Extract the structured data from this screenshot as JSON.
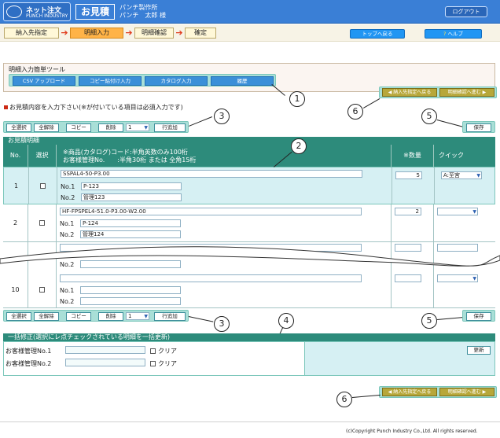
{
  "header": {
    "logo_name": "ネット注文",
    "logo_sub": "PUNCH INDUSTRY",
    "app_title": "お見積",
    "company": "パンチ製作所",
    "user": "パンチ　太郎 様",
    "logout": "ログアウト"
  },
  "steps": [
    {
      "label": "納入先指定"
    },
    {
      "label": "明細入力"
    },
    {
      "label": "明細確認"
    },
    {
      "label": "確定"
    }
  ],
  "step_arrow": "➔",
  "top_nav": {
    "back_top": "トップへ戻る",
    "help": "ヘルプ",
    "help_icon": "?"
  },
  "tools": {
    "title": "明細入力簡単ツール",
    "buttons": [
      "CSV アップロード",
      "コピー貼付け入力",
      "カタログ入力",
      "履歴"
    ]
  },
  "nav_buttons": {
    "back": "◀ 納入先指定へ戻る",
    "next": "明細確認へ進む ▶"
  },
  "instruction": "お見積内容を入力下さい(※が付いている項目は必須入力です)",
  "ops": {
    "select_all": "全選択",
    "deselect_all": "全解除",
    "copy": "コピー",
    "delete": "削除",
    "count": "1",
    "add_row": "行追加",
    "save": "保存"
  },
  "table": {
    "section_title": "お見積明細",
    "col_no": "No.",
    "col_select": "選択",
    "col_code_line1": "※商品(カタログ)コード:半角英数のみ100桁",
    "col_code_line2": "お客様管理No.　　:半角30桁 または 全角15桁",
    "col_qty": "※数量",
    "col_quick": "クイック",
    "label_no1": "No.1",
    "label_no2": "No.2",
    "rows": [
      {
        "no": "1",
        "code": "SSPAL4-50-P3.00",
        "no1": "P-123",
        "no2": "管理123",
        "qty": "5",
        "quick": "A:至宮"
      },
      {
        "no": "2",
        "code": "HF-FPSPEL4-51.0-P3.00-W2.00",
        "no1": "P-124",
        "no2": "管理124",
        "qty": "2",
        "quick": ""
      },
      {
        "no": "",
        "code": "",
        "no1": "",
        "no2": "",
        "qty": "",
        "quick": ""
      },
      {
        "no": "10",
        "code": "",
        "no1": "",
        "no2": "",
        "qty": "",
        "quick": ""
      }
    ]
  },
  "bulk": {
    "title": "一括修正(選択にレ点チェックされている明細を一括更新)",
    "field1": "お客様管理No.1",
    "field2": "お客様管理No.2",
    "clear": "クリア",
    "update": "更新"
  },
  "callouts": [
    "1",
    "2",
    "3",
    "4",
    "5",
    "6"
  ],
  "copyright": "(c)Copyright Punch Industry Co.,Ltd. All rights reserved.",
  "colors": {
    "header": "#3a7fd6",
    "teal": "#2d8b7b",
    "accent": "#ffb347",
    "nav_button": "#b7a73a"
  }
}
